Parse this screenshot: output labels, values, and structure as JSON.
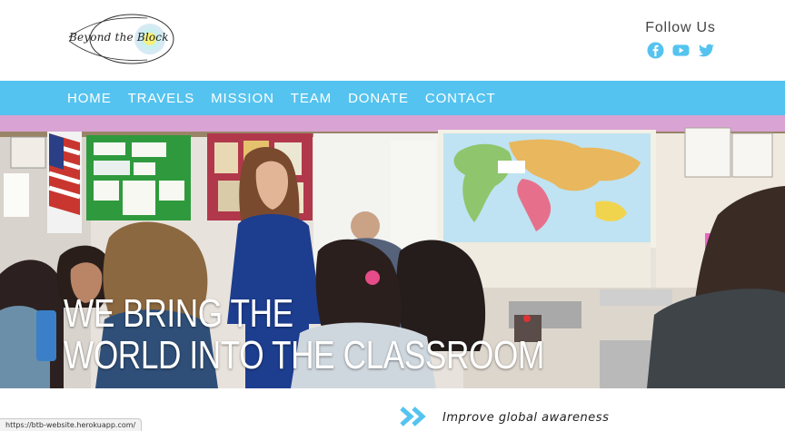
{
  "header": {
    "logo_text": "Beyond the Block",
    "follow_label": "Follow Us",
    "social": [
      {
        "icon": "facebook-icon",
        "color": "#55c3ef"
      },
      {
        "icon": "youtube-icon",
        "color": "#55c3ef"
      },
      {
        "icon": "twitter-icon",
        "color": "#55c3ef"
      }
    ]
  },
  "nav": {
    "items": [
      "HOME",
      "TRAVELS",
      "MISSION",
      "TEAM",
      "DONATE",
      "CONTACT"
    ],
    "background": "#55c3ef"
  },
  "hero": {
    "title_line1": "WE BRING THE",
    "title_line2": "WORLD INTO THE CLASSROOM"
  },
  "feature": {
    "tagline": "Improve global awareness",
    "icon": "double-chevron-right-icon"
  },
  "status_bar": {
    "url": "https://btb-website.herokuapp.com/"
  }
}
